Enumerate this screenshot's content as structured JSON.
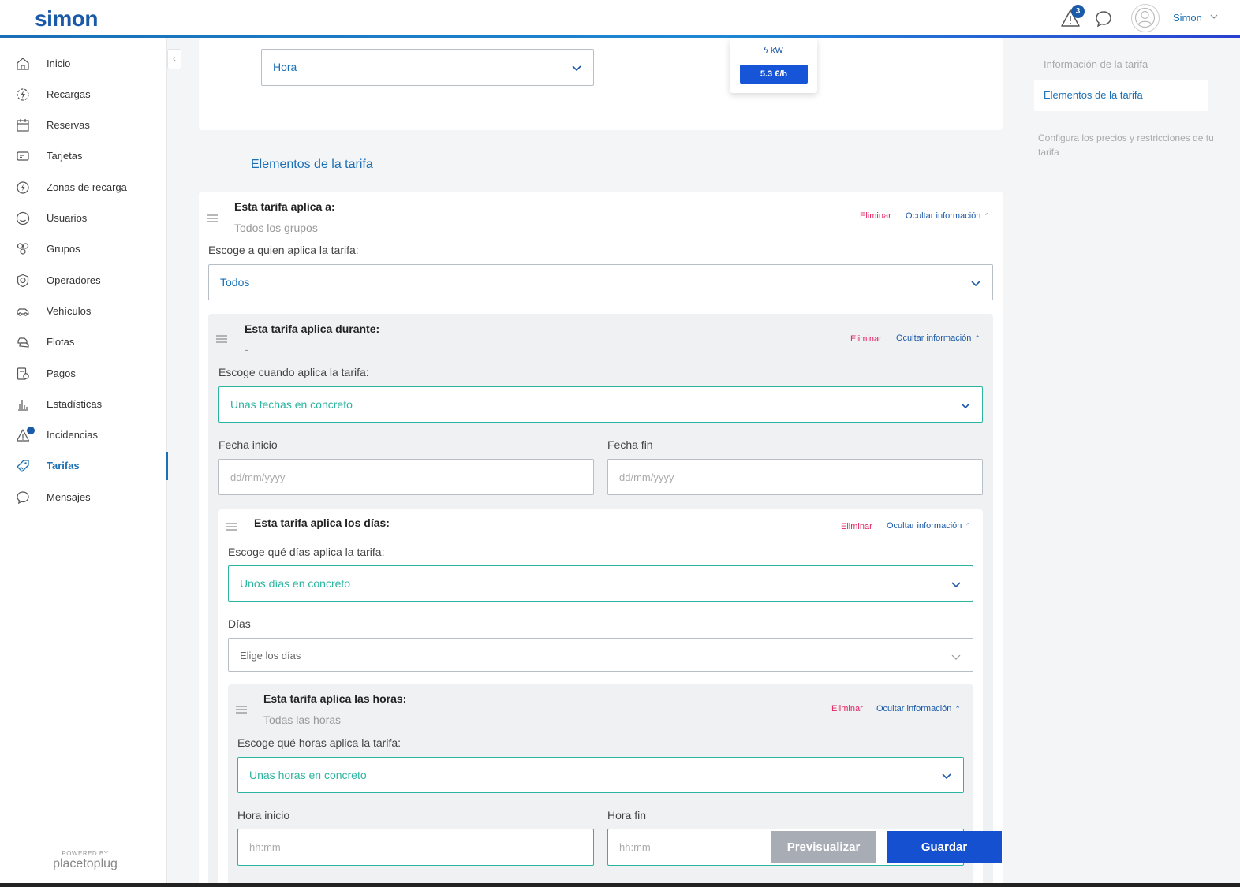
{
  "header": {
    "logo": "simon",
    "alerts_count": "3",
    "user_name": "Simon"
  },
  "sidebar": {
    "items": [
      {
        "label": "Inicio",
        "icon": "home-icon"
      },
      {
        "label": "Recargas",
        "icon": "charging-icon"
      },
      {
        "label": "Reservas",
        "icon": "calendar-icon"
      },
      {
        "label": "Tarjetas",
        "icon": "card-icon"
      },
      {
        "label": "Zonas de recarga",
        "icon": "charging-zone-icon"
      },
      {
        "label": "Usuarios",
        "icon": "user-icon"
      },
      {
        "label": "Grupos",
        "icon": "group-icon"
      },
      {
        "label": "Operadores",
        "icon": "operator-icon"
      },
      {
        "label": "Vehículos",
        "icon": "car-icon"
      },
      {
        "label": "Flotas",
        "icon": "fleet-icon"
      },
      {
        "label": "Pagos",
        "icon": "payment-icon"
      },
      {
        "label": "Estadísticas",
        "icon": "stats-icon"
      },
      {
        "label": "Incidencias",
        "icon": "alert-icon"
      },
      {
        "label": "Tarifas",
        "icon": "tag-icon",
        "active": true
      },
      {
        "label": "Mensajes",
        "icon": "message-icon"
      }
    ],
    "powered_by": "POWERED BY",
    "powered_brand": "placetoplug"
  },
  "top_card": {
    "unit_select": "Hora",
    "price_unit": "ϟ kW",
    "price_value": "5.3 €/h"
  },
  "section_title": "Elementos de la tarifa",
  "block1": {
    "title": "Esta tarifa aplica a:",
    "subtitle": "Todos los grupos",
    "delete": "Eliminar",
    "hide": "Ocultar información",
    "prompt": "Escoge a quien aplica la tarifa:",
    "select": "Todos"
  },
  "block2": {
    "title": "Esta tarifa aplica durante:",
    "subtitle": "-",
    "delete": "Eliminar",
    "hide": "Ocultar información",
    "prompt": "Escoge cuando aplica la tarifa:",
    "select": "Unas fechas en concreto",
    "start_label": "Fecha inicio",
    "end_label": "Fecha fin",
    "date_placeholder": "dd/mm/yyyy"
  },
  "block3": {
    "title": "Esta tarifa aplica los días:",
    "delete": "Eliminar",
    "hide": "Ocultar información",
    "prompt": "Escoge qué días aplica la tarifa:",
    "select": "Unos días en concreto",
    "days_label": "Días",
    "days_select": "Elige los días"
  },
  "block4": {
    "title": "Esta tarifa aplica las horas:",
    "subtitle": "Todas las horas",
    "delete": "Eliminar",
    "hide": "Ocultar información",
    "prompt": "Escoge qué horas aplica la tarifa:",
    "select": "Unas horas en concreto",
    "start_label": "Hora inicio",
    "end_label": "Hora fin",
    "time_placeholder": "hh:mm"
  },
  "actions": {
    "preview": "Previsualizar",
    "save": "Guardar"
  },
  "right_panel": {
    "items": [
      "Información de la tarifa",
      "Elementos de la tarifa"
    ],
    "description": "Configura los precios y restricciones de tu tarifa"
  },
  "colors": {
    "primary": "#1a6fb5",
    "accent_teal": "#2bb5a0",
    "danger": "#e0245e",
    "save_button": "#1550d0"
  }
}
